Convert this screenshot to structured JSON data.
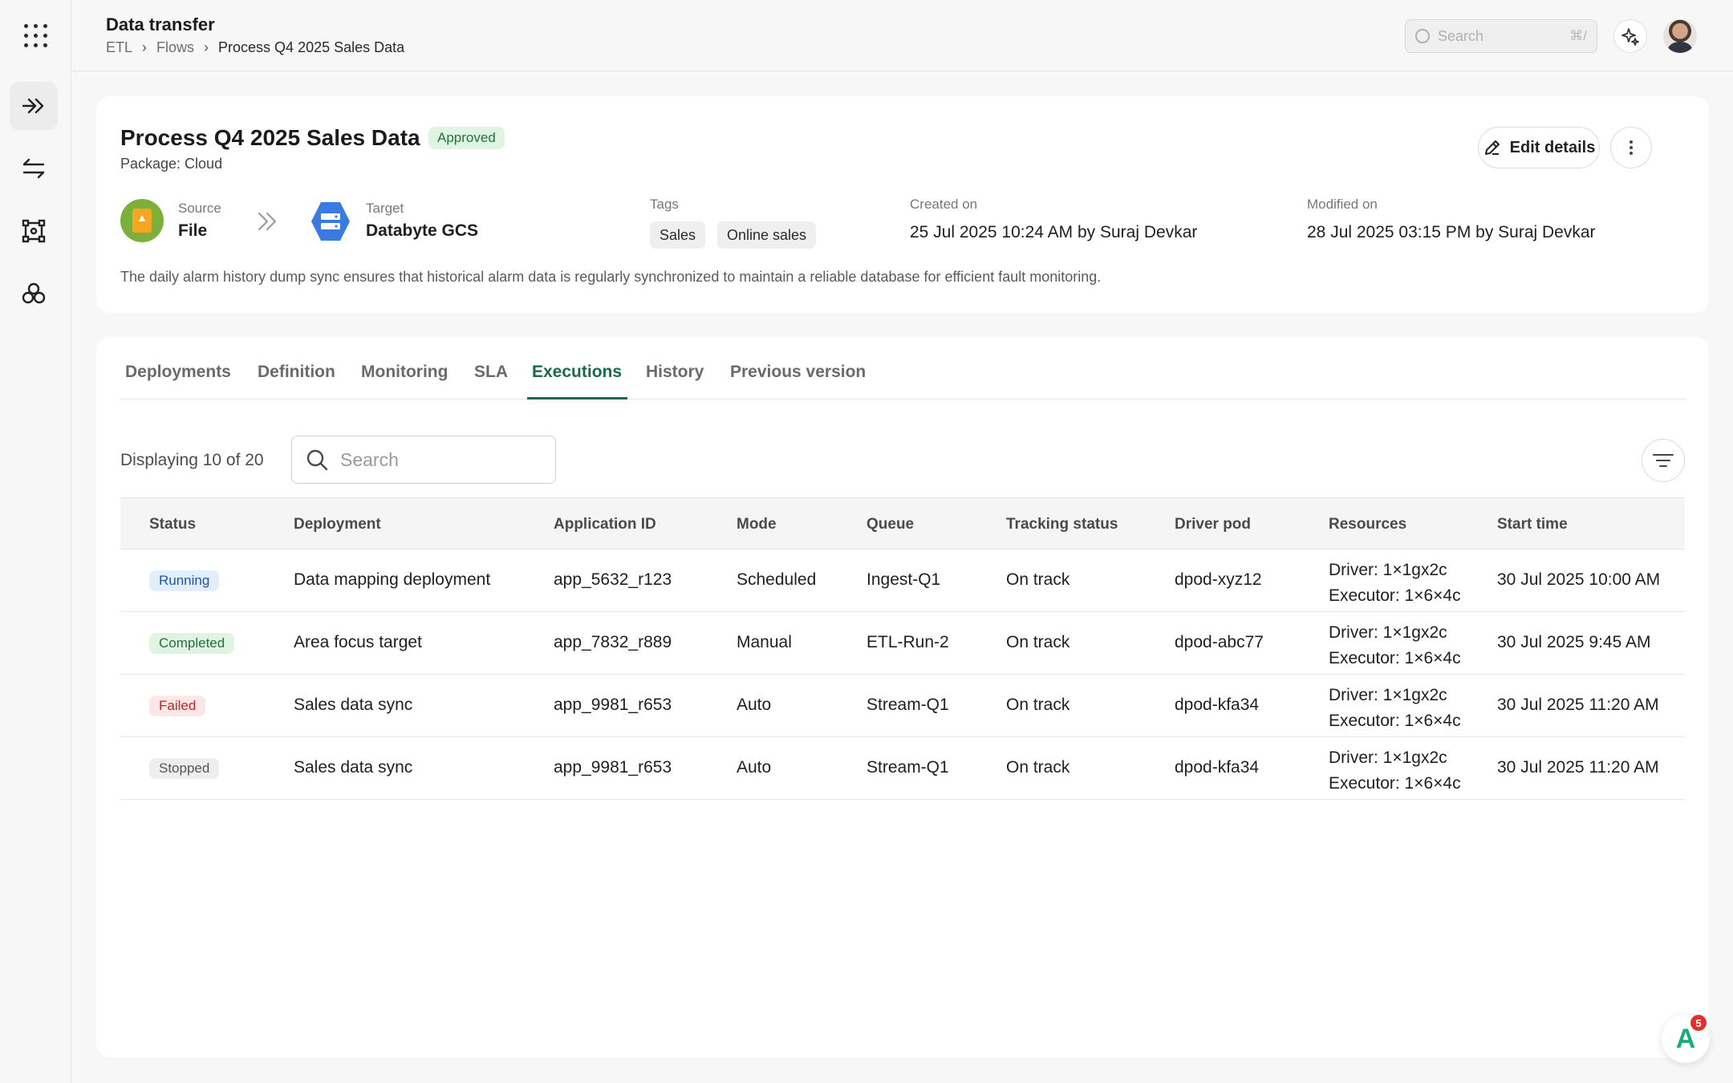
{
  "header": {
    "title": "Data transfer",
    "breadcrumbs": [
      "ETL",
      "Flows",
      "Process Q4 2025 Sales Data"
    ],
    "search_placeholder": "Search",
    "search_shortcut": "⌘/"
  },
  "flow": {
    "name": "Process Q4 2025 Sales Data",
    "status": "Approved",
    "package": "Package: Cloud",
    "edit_label": "Edit details",
    "source_label": "Source",
    "source_value": "File",
    "target_label": "Target",
    "target_value": "Databyte GCS",
    "tags_label": "Tags",
    "tags": [
      "Sales",
      "Online sales"
    ],
    "created_label": "Created on",
    "created_value": "25 Jul 2025 10:24 AM by Suraj Devkar",
    "modified_label": "Modified on",
    "modified_value": "28 Jul 2025 03:15 PM by Suraj Devkar",
    "description": "The daily alarm history dump sync ensures that historical alarm data is regularly synchronized to maintain a reliable database for efficient fault monitoring."
  },
  "tabs": [
    "Deployments",
    "Definition",
    "Monitoring",
    "SLA",
    "Executions",
    "History",
    "Previous version"
  ],
  "active_tab": "Executions",
  "executions": {
    "displaying": "Displaying 10 of 20",
    "search_placeholder": "Search",
    "columns": [
      "Status",
      "Deployment",
      "Application ID",
      "Mode",
      "Queue",
      "Tracking status",
      "Driver pod",
      "Resources",
      "Start time"
    ],
    "rows": [
      {
        "status": "Running",
        "deployment": "Data mapping deployment",
        "app_id": "app_5632_r123",
        "mode": "Scheduled",
        "queue": "Ingest-Q1",
        "tracking": "On track",
        "driver_pod": "dpod-xyz12",
        "res_driver": "Driver: 1×1gx2c",
        "res_executor": "Executor: 1×6×4c",
        "start": "30 Jul 2025 10:00 AM"
      },
      {
        "status": "Completed",
        "deployment": "Area focus target",
        "app_id": "app_7832_r889",
        "mode": "Manual",
        "queue": "ETL-Run-2",
        "tracking": "On track",
        "driver_pod": "dpod-abc77",
        "res_driver": "Driver: 1×1gx2c",
        "res_executor": "Executor: 1×6×4c",
        "start": "30 Jul 2025 9:45 AM"
      },
      {
        "status": "Failed",
        "deployment": "Sales data sync",
        "app_id": "app_9981_r653",
        "mode": "Auto",
        "queue": "Stream-Q1",
        "tracking": "On track",
        "driver_pod": "dpod-kfa34",
        "res_driver": "Driver: 1×1gx2c",
        "res_executor": "Executor: 1×6×4c",
        "start": "30 Jul 2025 11:20 AM"
      },
      {
        "status": "Stopped",
        "deployment": "Sales data sync",
        "app_id": "app_9981_r653",
        "mode": "Auto",
        "queue": "Stream-Q1",
        "tracking": "On track",
        "driver_pod": "dpod-kfa34",
        "res_driver": "Driver: 1×1gx2c",
        "res_executor": "Executor: 1×6×4c",
        "start": "30 Jul 2025 11:20 AM"
      }
    ]
  },
  "assistant": {
    "badge_count": "5",
    "letter": "A"
  },
  "colors": {
    "accent": "#176b4c",
    "running": "#1e55a8",
    "completed": "#24703a",
    "failed": "#c02626",
    "stopped": "#555555"
  }
}
